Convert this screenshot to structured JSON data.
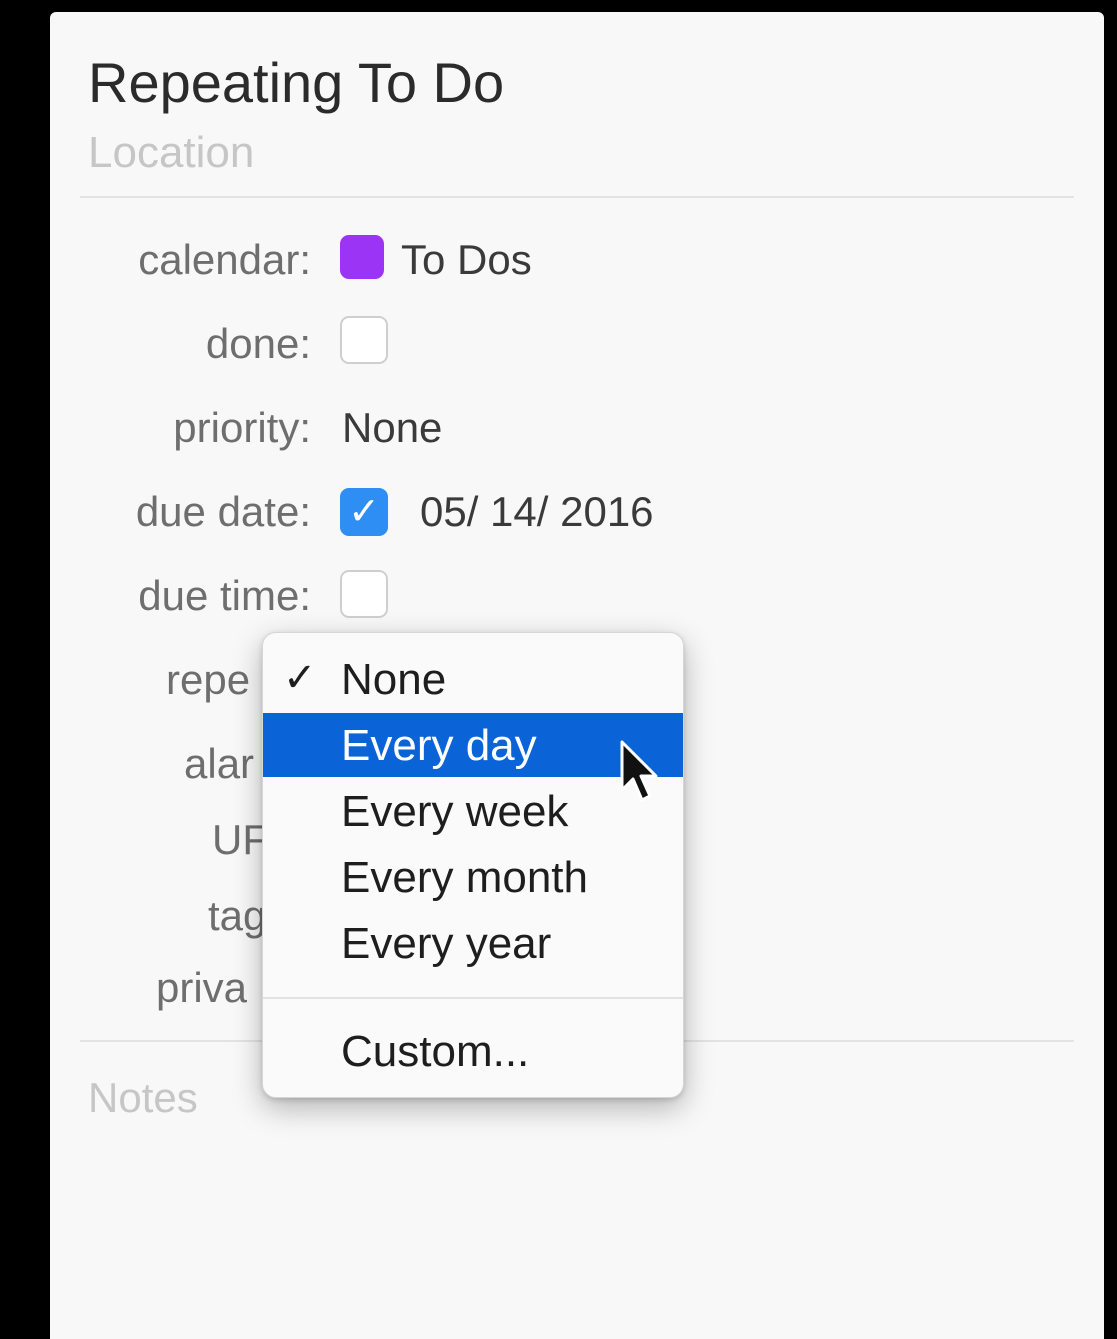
{
  "reminder": {
    "title": "Repeating To Do",
    "location_placeholder": "Location",
    "notes_placeholder": "Notes"
  },
  "fields": {
    "calendar": {
      "label": "calendar:",
      "value": "To Dos",
      "color": "#9b34f5"
    },
    "done": {
      "label": "done:",
      "checked": false
    },
    "priority": {
      "label": "priority:",
      "value": "None"
    },
    "due_date": {
      "label": "due date:",
      "checked": true,
      "value": "05/ 14/ 2016"
    },
    "due_time": {
      "label": "due time:",
      "checked": false
    },
    "repeat": {
      "label_visible": "repe"
    },
    "alarm": {
      "label_visible": "alar"
    },
    "url": {
      "label_visible": "UF"
    },
    "tags": {
      "label_visible": "tag"
    },
    "private": {
      "label_visible": "priva"
    }
  },
  "repeat_menu": {
    "check_glyph": "✓",
    "items": [
      {
        "label": "None",
        "selected": true
      },
      {
        "label": "Every day",
        "highlighted": true
      },
      {
        "label": "Every week"
      },
      {
        "label": "Every month"
      },
      {
        "label": "Every year"
      },
      {
        "label": "Custom..."
      }
    ]
  },
  "colors": {
    "highlight": "#0a64d8",
    "checkbox_checked": "#2f8ef4"
  }
}
